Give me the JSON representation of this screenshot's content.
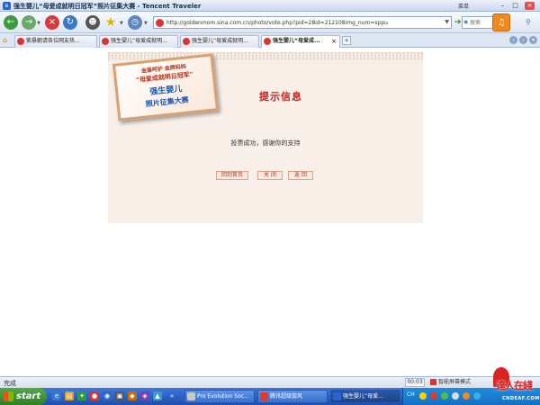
{
  "window": {
    "title": "强生婴儿“母爱成就明日冠军”照片征集大赛 - Tencent Traveler",
    "menu_label": "菜单"
  },
  "navbar": {
    "url": "http://goldenmom.sina.com.cn/photo/vote.php?pid=28id=212108img_num=sppu",
    "search_placeholder": "搜索"
  },
  "tabs": [
    {
      "label": "紫悬朝请各位网友热..."
    },
    {
      "label": "强生婴儿“母爱成就明..."
    },
    {
      "label": "强生婴儿“母爱成就明..."
    },
    {
      "label": "强生婴儿“母爱成..."
    }
  ],
  "page": {
    "poster": {
      "line1": "金盾呵护  金牌妈妈",
      "line2": "“母爱成就明日冠军”",
      "line3": "强生婴儿",
      "line4": "照片征集大赛"
    },
    "heading": "提示信息",
    "message": "投票成功，感谢你的支持",
    "buttons": {
      "home": "回到首页",
      "close": "关 闭",
      "back": "返 回"
    }
  },
  "statusbar": {
    "status": "完成",
    "time": "00:03",
    "mode": "智能屏幕模式"
  },
  "taskbar": {
    "start_label": "start",
    "tasks": [
      {
        "label": "Pro Evolution Soc..."
      },
      {
        "label": "腾讯超级旋风"
      },
      {
        "label": "强生婴儿“母爱..."
      }
    ],
    "tray_lang": "CH"
  },
  "watermark": {
    "text": "達人在綫",
    "sub": "CNDEAF.COM"
  },
  "colors": {
    "heading_red": "#c7231b",
    "panel_bg": "#f8efe9",
    "taskbar_blue": "#2a5fc4"
  }
}
